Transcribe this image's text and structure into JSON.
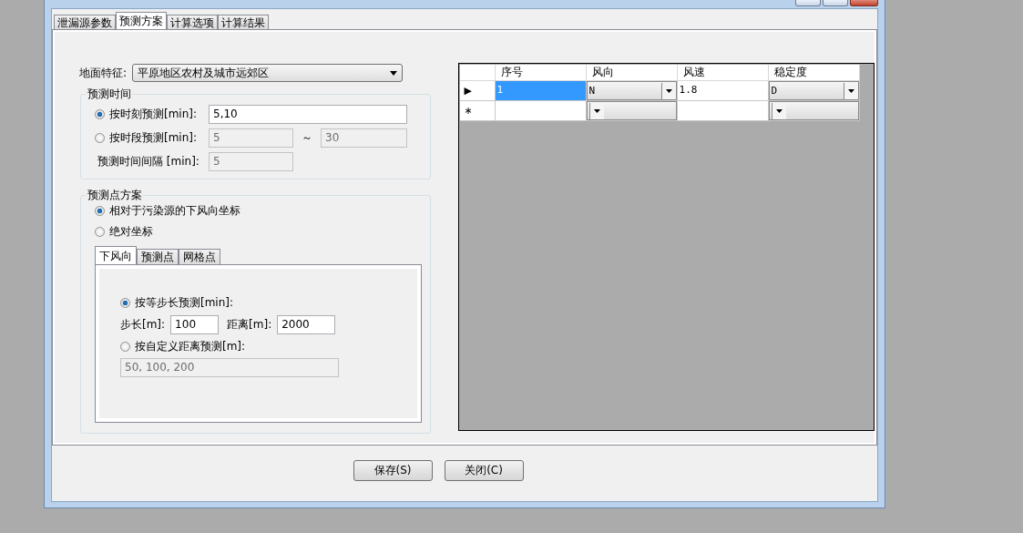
{
  "tabs": [
    {
      "label": "泄漏源参数",
      "selected": false
    },
    {
      "label": "预测方案",
      "selected": true
    },
    {
      "label": "计算选项",
      "selected": false
    },
    {
      "label": "计算结果",
      "selected": false
    }
  ],
  "terrain": {
    "label": "地面特征:",
    "value": "平原地区农村及城市远郊区"
  },
  "time_group": {
    "title": "预测时间",
    "by_moment": {
      "label": "按时刻预测[min]:",
      "selected": true,
      "value": "5,10",
      "disabled": false
    },
    "by_period": {
      "label": "按时段预测[min]:",
      "selected": false,
      "from": "5",
      "separator": "～",
      "to": "30",
      "disabled": true
    },
    "interval": {
      "label": "预测时间间隔 [min]:",
      "value": "5",
      "disabled": true
    }
  },
  "point_group": {
    "title": "预测点方案",
    "options": [
      {
        "label": "相对于污染源的下风向坐标",
        "selected": true
      },
      {
        "label": "绝对坐标",
        "selected": false
      }
    ],
    "tabs": [
      {
        "label": "下风向",
        "selected": true
      },
      {
        "label": "预测点",
        "selected": false
      },
      {
        "label": "网格点",
        "selected": false
      }
    ],
    "step_mode": {
      "label": "按等步长预测[min]:",
      "selected": true
    },
    "step": {
      "label": "步长[m]:",
      "value": "100",
      "disabled": false
    },
    "distance": {
      "label": "距离[m]:",
      "value": "2000",
      "disabled": false
    },
    "custom_mode": {
      "label": "按自定义距离预测[m]:",
      "selected": false
    },
    "custom_value": {
      "value": "50, 100, 200",
      "disabled": true
    }
  },
  "grid": {
    "columns": [
      "序号",
      "风向",
      "风速",
      "稳定度"
    ],
    "rows": [
      {
        "kind": "data",
        "marker": "▶",
        "selected": true,
        "cells": [
          "1",
          "N",
          "1.8",
          "D"
        ]
      },
      {
        "kind": "new",
        "marker": "∗",
        "selected": false
      }
    ]
  },
  "buttons": [
    {
      "label": "保存(S)"
    },
    {
      "label": "关闭(C)"
    }
  ]
}
